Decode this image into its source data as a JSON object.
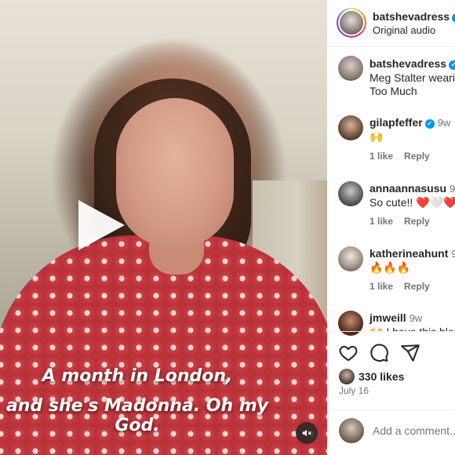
{
  "post": {
    "author": "batshevadress",
    "audio": "Original audio"
  },
  "video": {
    "caption_line1": "A month in London,",
    "caption_line2": "and she's Madonna. Oh my God."
  },
  "description": {
    "author": "batshevadress",
    "line1": "Meg Stalter weari",
    "line2": "Too Much"
  },
  "comments": [
    {
      "user": "gilapfeffer",
      "verified": true,
      "ago": "9w",
      "text": "🙌",
      "likes": "1 like",
      "reply": "Reply"
    },
    {
      "user": "annaannasusu",
      "verified": false,
      "ago": "9w",
      "text": "So cute!! ❤️🤍❤️",
      "likes": "1 like",
      "reply": "Reply"
    },
    {
      "user": "katherineahunt",
      "verified": false,
      "ago": "9",
      "text": "🔥🔥🔥",
      "likes": "1 like",
      "reply": "Reply"
    },
    {
      "user": "jmweill",
      "verified": false,
      "ago": "9w",
      "text": "🙌 I have this blo",
      "likes": "",
      "reply": ""
    }
  ],
  "stats": {
    "likes": "330 likes",
    "date": "July 16"
  },
  "composer": {
    "placeholder": "Add a comment..."
  },
  "icons": [
    "play-icon",
    "mute-icon",
    "heart-icon",
    "comment-icon",
    "share-icon",
    "verified-icon"
  ],
  "colors": {
    "verified": "#0095f6",
    "text": "#262626",
    "muted": "#737373",
    "heart_red": "#ed4956"
  }
}
